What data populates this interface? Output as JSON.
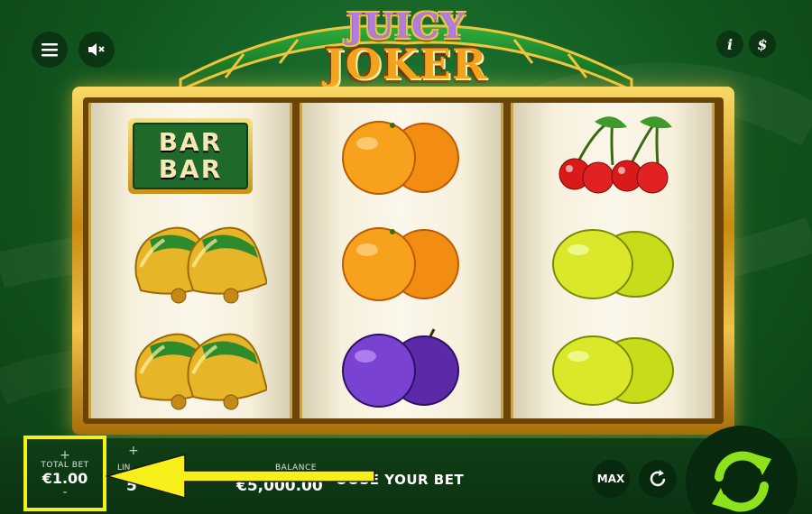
{
  "game": {
    "title_line1": "JUICY",
    "title_line2": "JOKER"
  },
  "top_bar": {
    "menu_icon": "hamburger-icon",
    "sound_icon": "muted-speaker-icon",
    "info_label": "i",
    "paytable_label": "$"
  },
  "reels": [
    [
      "bar-bar",
      "bell",
      "bell"
    ],
    [
      "orange",
      "orange",
      "plum"
    ],
    [
      "cherry",
      "lemon",
      "lemon"
    ]
  ],
  "bar_symbol": {
    "line1": "BAR",
    "line2": "BAR"
  },
  "bottom_bar": {
    "total_bet_label": "TOTAL BET",
    "total_bet_value": "€1.00",
    "plus": "+",
    "minus": "-",
    "lines_label": "LIN",
    "lines_value": "5",
    "balance_label": "BALANCE",
    "balance_value": "€5,000.00",
    "choose_text": "OOSE YOUR BET",
    "max_label": "MAX"
  },
  "colors": {
    "highlight": "#f7ef1a",
    "frame_gold": "#e0b030",
    "spin_green": "#8ee21c"
  }
}
